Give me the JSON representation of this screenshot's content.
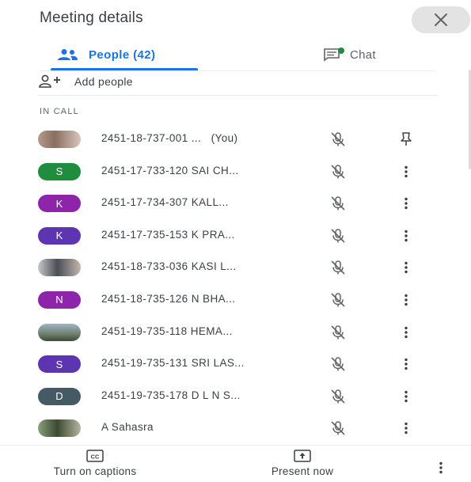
{
  "header": {
    "title": "Meeting details",
    "close_icon": "close-icon"
  },
  "tabs": [
    {
      "label": "People (42)",
      "icon": "people-icon",
      "active": true
    },
    {
      "label": "Chat",
      "icon": "chat-icon",
      "active": false
    }
  ],
  "add_people": {
    "label": "Add people",
    "icon": "add-person-icon"
  },
  "section": {
    "label": "IN CALL"
  },
  "participants": [
    {
      "name": "2451-18-737-001 ...   (You)",
      "avatar_letter": "",
      "avatar_type": "photo",
      "avatar_color": "",
      "mic": "mic-off-icon",
      "action": "pin-icon"
    },
    {
      "name": "2451-17-733-120 SAI CH...",
      "avatar_letter": "S",
      "avatar_type": "letter",
      "avatar_color": "#1e8e3e",
      "mic": "mic-off-icon",
      "action": "more-vert-icon"
    },
    {
      "name": "2451-17-734-307 KALL...",
      "avatar_letter": "K",
      "avatar_type": "letter",
      "avatar_color": "#8e24aa",
      "mic": "mic-off-icon",
      "action": "more-vert-icon"
    },
    {
      "name": "2451-17-735-153 K PRA...",
      "avatar_letter": "K",
      "avatar_type": "letter",
      "avatar_color": "#5e35b1",
      "mic": "mic-off-icon",
      "action": "more-vert-icon"
    },
    {
      "name": "2451-18-733-036 KASI L...",
      "avatar_letter": "",
      "avatar_type": "photo2",
      "avatar_color": "",
      "mic": "mic-off-icon",
      "action": "more-vert-icon"
    },
    {
      "name": "2451-18-735-126 N BHA...",
      "avatar_letter": "N",
      "avatar_type": "letter",
      "avatar_color": "#8e24aa",
      "mic": "mic-off-icon",
      "action": "more-vert-icon"
    },
    {
      "name": "2451-19-735-118 HEMA...",
      "avatar_letter": "",
      "avatar_type": "photo3",
      "avatar_color": "",
      "mic": "mic-off-icon",
      "action": "more-vert-icon"
    },
    {
      "name": "2451-19-735-131 SRI LAS...",
      "avatar_letter": "S",
      "avatar_type": "letter",
      "avatar_color": "#5e35b1",
      "mic": "mic-off-icon",
      "action": "more-vert-icon"
    },
    {
      "name": "2451-19-735-178 D L N S...",
      "avatar_letter": "D",
      "avatar_type": "letter",
      "avatar_color": "#455a64",
      "mic": "mic-off-icon",
      "action": "more-vert-icon"
    },
    {
      "name": "A Sahasra",
      "avatar_letter": "",
      "avatar_type": "photo4",
      "avatar_color": "",
      "mic": "mic-off-icon",
      "action": "more-vert-icon"
    }
  ],
  "bottom_bar": {
    "captions_label": "Turn on captions",
    "captions_icon": "closed-caption-icon",
    "present_label": "Present now",
    "present_icon": "present-screen-icon",
    "more_icon": "more-vert-icon"
  },
  "colors": {
    "accent": "#1a73e8",
    "text": "#3c4043",
    "muted": "#5f6368"
  }
}
